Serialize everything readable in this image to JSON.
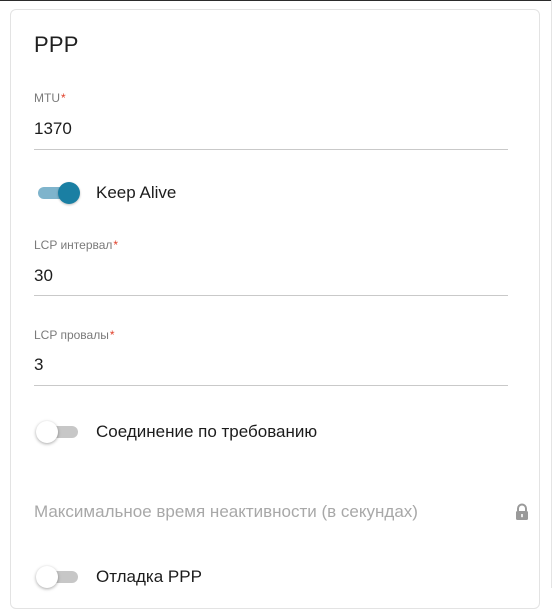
{
  "section": {
    "title": "PPP"
  },
  "mtu": {
    "label": "MTU",
    "required_mark": "*",
    "value": "1370"
  },
  "keep_alive": {
    "label": "Keep Alive",
    "enabled": true
  },
  "lcp_interval": {
    "label": "LCP интервал",
    "required_mark": "*",
    "value": "30"
  },
  "lcp_fails": {
    "label": "LCP провалы",
    "required_mark": "*",
    "value": "3"
  },
  "on_demand": {
    "label": "Соединение по требованию",
    "enabled": false
  },
  "max_idle": {
    "placeholder": "Максимальное время неактивности (в секундах)",
    "icon": "lock-icon",
    "disabled": true
  },
  "ppp_debug": {
    "label": "Отладка PPP",
    "enabled": false
  },
  "colors": {
    "accent": "#1a7fa3",
    "accent_track": "#7fb4cc",
    "required": "#e0402a"
  }
}
